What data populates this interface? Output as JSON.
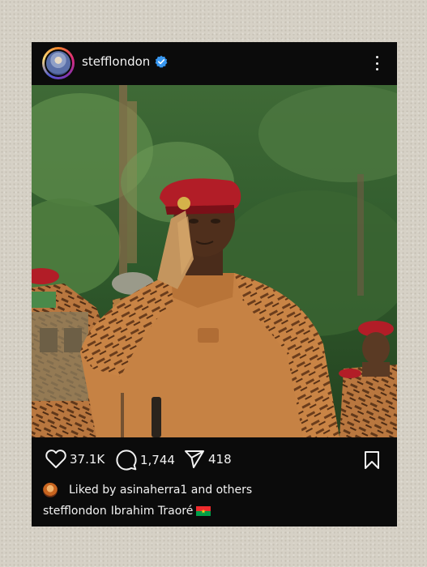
{
  "post": {
    "username": "stefflondon",
    "verified": true,
    "icons": {
      "verified": "verified-badge-icon",
      "more": "more-options-icon"
    }
  },
  "actions": {
    "likes_count": "37.1K",
    "comments_count": "1,744",
    "shares_count": "418",
    "icons": [
      "heart-icon",
      "comment-icon",
      "share-icon",
      "bookmark-icon"
    ]
  },
  "likes": {
    "text": "Liked by asinaherra1 and others"
  },
  "caption": {
    "username": "stefflondon",
    "text": "Ibrahim Traoré"
  },
  "colors": {
    "card_background": "#0b0b0b",
    "page_background": "#d6d1c6",
    "verified_blue": "#3897f0",
    "text": "#f2f2f2",
    "beret_red": "#b21d27"
  }
}
